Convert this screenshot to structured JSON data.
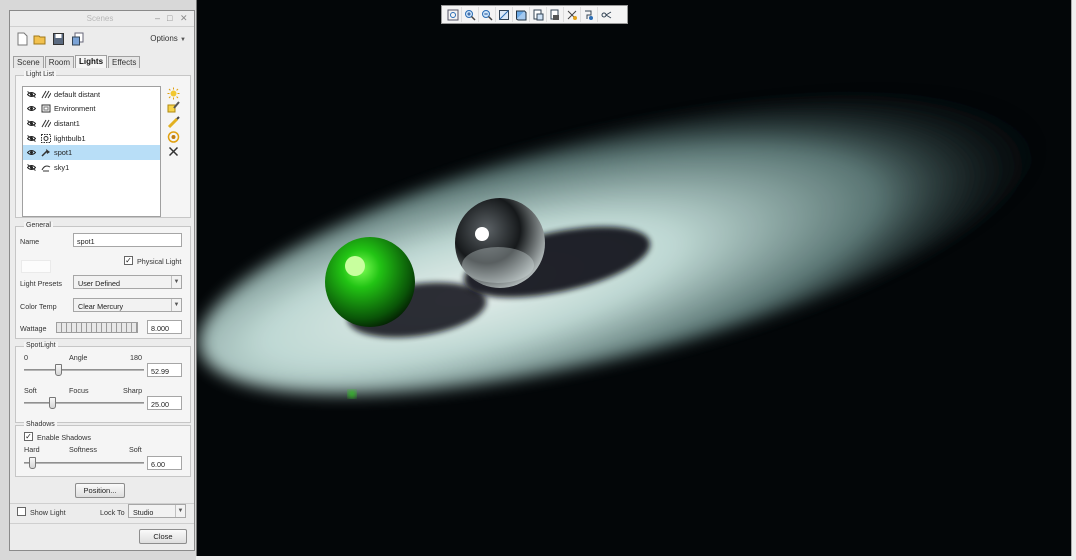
{
  "panel": {
    "title": "Scenes",
    "options_label": "Options",
    "tabs": [
      {
        "label": "Scene",
        "active": false
      },
      {
        "label": "Room",
        "active": false
      },
      {
        "label": "Lights",
        "active": true
      },
      {
        "label": "Effects",
        "active": false
      }
    ],
    "light_list": {
      "group_label": "Light List",
      "items": [
        {
          "name": "default distant",
          "type": "distant",
          "visible": false,
          "selected": false
        },
        {
          "name": "Environment",
          "type": "environment",
          "visible": true,
          "selected": false
        },
        {
          "name": "distant1",
          "type": "distant",
          "visible": false,
          "selected": false
        },
        {
          "name": "lightbulb1",
          "type": "lightbulb",
          "visible": false,
          "selected": false
        },
        {
          "name": "spot1",
          "type": "spot",
          "visible": true,
          "selected": true
        },
        {
          "name": "sky1",
          "type": "sky",
          "visible": false,
          "selected": false
        }
      ]
    },
    "general": {
      "group_label": "General",
      "name_label": "Name",
      "name_value": "spot1",
      "physical_light_label": "Physical Light",
      "physical_light_checked": true,
      "presets_label": "Light Presets",
      "presets_value": "User Defined",
      "color_temp_label": "Color Temp",
      "color_temp_value": "Clear Mercury",
      "wattage_label": "Wattage",
      "wattage_value": "8.000"
    },
    "spotlight": {
      "group_label": "SpotLight",
      "angle_min": "0",
      "angle_label": "Angle",
      "angle_max": "180",
      "angle_value": "52.99",
      "focus_soft": "Soft",
      "focus_label": "Focus",
      "focus_sharp": "Sharp",
      "focus_value": "25.00"
    },
    "shadows": {
      "group_label": "Shadows",
      "enable_label": "Enable Shadows",
      "enable_checked": true,
      "softness_hard": "Hard",
      "softness_label": "Softness",
      "softness_soft": "Soft",
      "softness_value": "6.00"
    },
    "position_button": "Position...",
    "show_light_label": "Show Light",
    "show_light_checked": false,
    "lock_to_label": "Lock To",
    "lock_to_value": "Studio",
    "close_button": "Close"
  },
  "toolbar": {
    "icons": [
      "refit-icon",
      "zoom-in-icon",
      "zoom-out-icon",
      "view-orient-icon",
      "display-style-icon",
      "saved-views-icon",
      "layers-icon",
      "datum-display-icon",
      "spin-center-icon",
      "annotation-display-icon"
    ]
  },
  "colors": {
    "viewport_bg": "#030608",
    "selection": "#b8def7",
    "green_sphere": "#2ecc1a",
    "spot_light": "#dff2ee"
  }
}
